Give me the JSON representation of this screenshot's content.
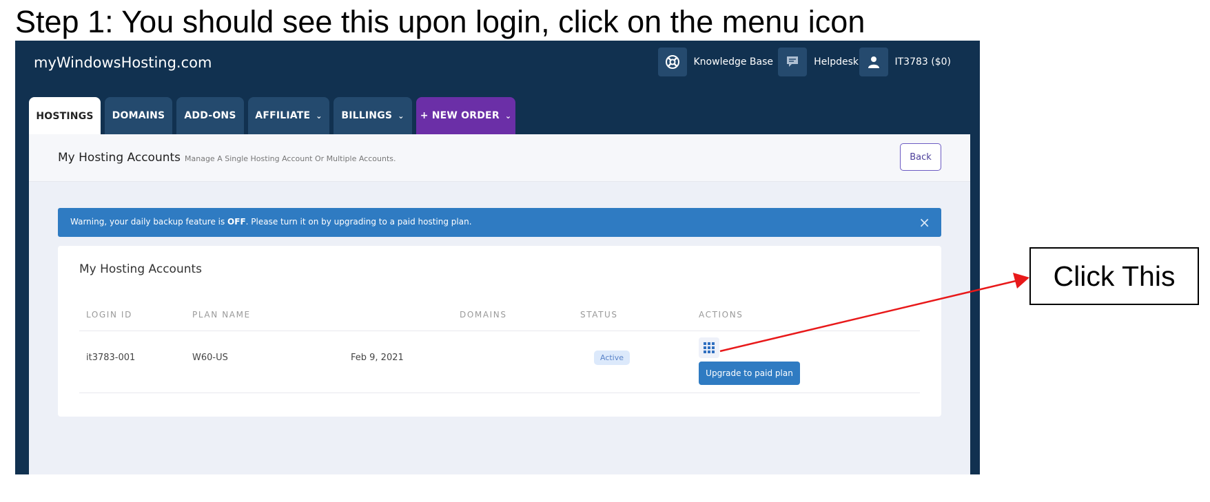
{
  "caption": "Step 1: You should see this upon login, click on the menu icon",
  "callout": "Click This",
  "app": {
    "brand": "myWindowsHosting.com",
    "topnav": {
      "knowledge_base": "Knowledge Base",
      "helpdesk": "Helpdesk",
      "account": "IT3783 ($0)"
    },
    "tabs": [
      {
        "label": "HOSTINGS"
      },
      {
        "label": "DOMAINS"
      },
      {
        "label": "ADD-ONS"
      },
      {
        "label": "AFFILIATE",
        "chevron": "⌄"
      },
      {
        "label": "BILLINGS",
        "chevron": "⌄"
      },
      {
        "label": "+ NEW ORDER",
        "chevron": "⌄"
      }
    ],
    "panel": {
      "title": "My Hosting Accounts",
      "subtitle": "Manage A Single Hosting Account Or Multiple Accounts.",
      "back_label": "Back"
    },
    "warning": {
      "prefix": "Warning, your daily backup feature is ",
      "strong": "OFF",
      "suffix": ". Please turn it on by upgrading to a paid hosting plan.",
      "close": "×"
    },
    "card": {
      "title": "My Hosting Accounts",
      "columns": [
        "LOGIN ID",
        "PLAN NAME",
        "DOMAINS",
        "STATUS",
        "ACTIONS"
      ],
      "rows": [
        {
          "login_id": "it3783-001",
          "plan_name": "W60-US",
          "date": "Feb 9, 2021",
          "domains": "",
          "status": "Active",
          "action_label": "Upgrade to paid plan"
        }
      ]
    }
  },
  "colors": {
    "header_bg": "#113150",
    "tab_bg": "#244a6e",
    "new_order": "#6b2fa7",
    "accent": "#2f7bc2",
    "arrow": "#e8191a"
  },
  "icons": [
    "knowledge-base-icon",
    "helpdesk-icon",
    "user-icon",
    "grid-menu-icon",
    "close-icon",
    "chevron-down-icon"
  ]
}
